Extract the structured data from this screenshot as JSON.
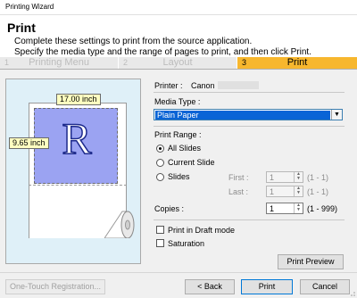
{
  "window": {
    "title": "Printing Wizard"
  },
  "header": {
    "title": "Print",
    "subtitle_line1": "Complete these settings to print from the source application.",
    "subtitle_line2": "Specify the media type and the range of pages to print, and then click Print."
  },
  "steps": [
    {
      "num": "1",
      "label": "Printing Menu",
      "active": false
    },
    {
      "num": "2",
      "label": "Layout",
      "active": false
    },
    {
      "num": "3",
      "label": "Print",
      "active": true
    }
  ],
  "preview": {
    "width_label": "17.00 inch",
    "height_label": "9.65 inch",
    "letter": "R"
  },
  "printer": {
    "label": "Printer :",
    "name": "Canon"
  },
  "media_type": {
    "label": "Media Type :",
    "selected": "Plain Paper"
  },
  "print_range": {
    "label": "Print Range :",
    "options": [
      "All Slides",
      "Current Slide",
      "Slides"
    ],
    "selected": "All Slides",
    "first": {
      "label": "First :",
      "value": "1",
      "range": "(1 - 1)"
    },
    "last": {
      "label": "Last :",
      "value": "1",
      "range": "(1 - 1)"
    }
  },
  "copies": {
    "label": "Copies :",
    "value": "1",
    "range": "(1 - 999)"
  },
  "options": {
    "draft_mode": {
      "label": "Print in Draft mode",
      "checked": false
    },
    "saturation": {
      "label": "Saturation",
      "checked": false
    }
  },
  "buttons": {
    "print_preview": "Print Preview",
    "one_touch": "One-Touch Registration...",
    "back": "< Back",
    "print": "Print",
    "cancel": "Cancel"
  },
  "colors": {
    "active_step": "#f7b72e",
    "preview_bg": "#dff0f8",
    "image_area": "#9ba3f2",
    "selection": "#0a64d6"
  }
}
